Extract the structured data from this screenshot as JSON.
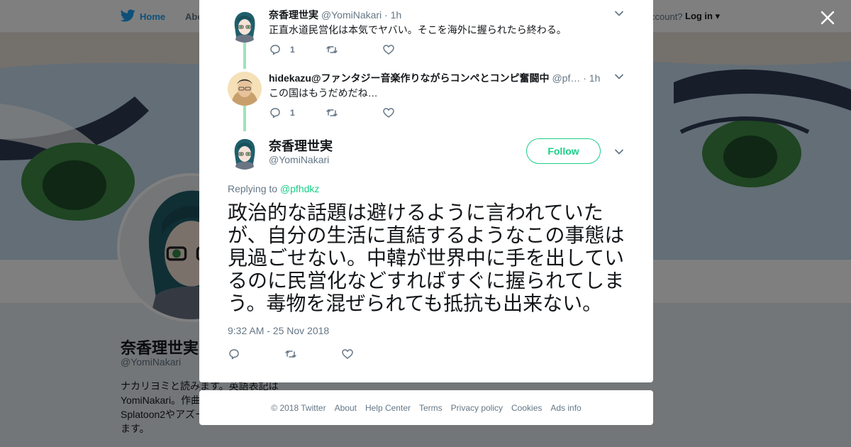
{
  "nav": {
    "home": "Home",
    "about": "Abo",
    "account_prompt": "ccount?",
    "login": "Log in"
  },
  "profile": {
    "name": "奈香理世実",
    "handle": "@YomiNakari",
    "bio": "ナカリヨミと読みます。英語表記は\nYomiNakari。作曲\nSplatoon2やアズー\nます。"
  },
  "context_tweets": [
    {
      "name": "奈香理世実",
      "handle": "@YomiNakari",
      "time": "· 1h",
      "text": "正直水道民営化は本気でヤバい。そこを海外に握られたら終わる。",
      "reply_count": "1"
    },
    {
      "name": "hidekazu@ファンタジー音楽作りながらコンペとコンピ奮闘中",
      "handle": "@pf…",
      "time": "· 1h",
      "text": "この国はもうだめだね…",
      "reply_count": "1"
    }
  ],
  "main_tweet": {
    "name": "奈香理世実",
    "handle": "@YomiNakari",
    "follow_label": "Follow",
    "replying_label": "Replying to",
    "replying_to": "@pfhdkz",
    "text": "政治的な話題は避けるように言われていたが、自分の生活に直結するようなこの事態は見過ごせない。中韓が世界中に手を出しているのに民営化などすればすぐに握られてしまう。毒物を混ぜられても抵抗も出来ない。",
    "timestamp": "9:32 AM - 25 Nov 2018"
  },
  "footer": {
    "copyright": "© 2018 Twitter",
    "links": [
      "About",
      "Help Center",
      "Terms",
      "Privacy policy",
      "Cookies",
      "Ads info"
    ]
  },
  "colors": {
    "accent_green": "#19cf86",
    "thread_line": "#9de3bd",
    "twitter_blue": "#1da1f2",
    "muted_text": "#657786",
    "overlay": "rgba(0,0,0,0.5)"
  },
  "icons": [
    "twitter-bird-icon",
    "close-icon",
    "reply-icon",
    "retweet-icon",
    "like-icon",
    "chevron-down-icon"
  ]
}
